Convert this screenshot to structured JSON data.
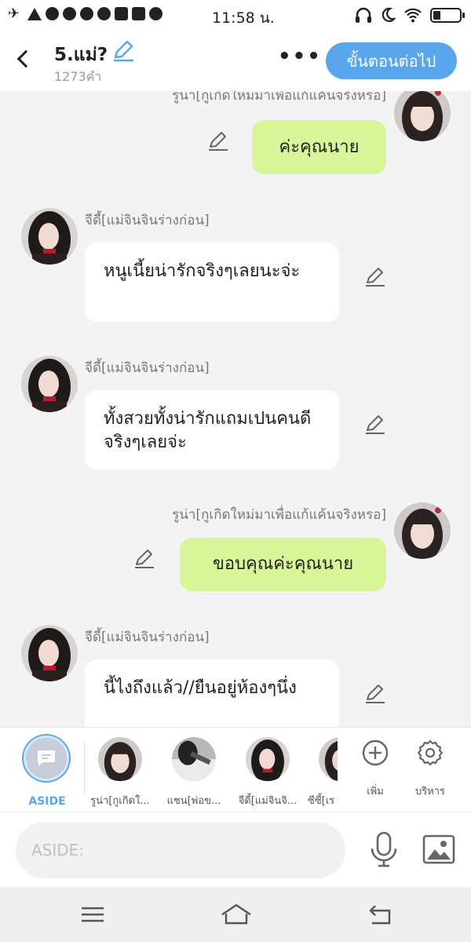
{
  "status_bar": {
    "time": "11:58 น."
  },
  "header": {
    "title": "5.แม่?",
    "word_count": "1273คำ",
    "more": "•••",
    "next_button": "ขั้นตอนต่อไป"
  },
  "messages": [
    {
      "side": "right",
      "name": "รูน่า[กูเกิดใหม่มาเพื่อแก้แค้นจริงหรอ]",
      "text": "ค่ะคุณนาย"
    },
    {
      "side": "left",
      "name": "จีดี้[แม่จินจินร่างก่อน]",
      "text": "หนูเนี้ยน่ารักจริงๆเลยนะจ่ะ"
    },
    {
      "side": "left",
      "name": "จีดี้[แม่จินจินร่างก่อน]",
      "text": "ทั้งสวยทั้งน่ารักแถมเปนคนดีจริงๆเลยจ่ะ"
    },
    {
      "side": "right",
      "name": "รูน่า[กูเกิดใหม่มาเพื่อแก้แค้นจริงหรอ]",
      "text": "ขอบคุณค่ะคุณนาย"
    },
    {
      "side": "left",
      "name": "จีดี้[แม่จินจินร่างก่อน]",
      "text": "นี้ไงถึงแล้ว//ยืนอยู่ห้องๆนึ่ง"
    }
  ],
  "character_bar": {
    "aside_label": "ASIDE",
    "characters": [
      {
        "label": "รูน่า[กูเกิดใ..."
      },
      {
        "label": "แชน[พ่อข..."
      },
      {
        "label": "จีดี้[แม่จินจิ..."
      },
      {
        "label": "ซีซี้[เร"
      }
    ],
    "add_label": "เพิ่ม",
    "manage_label": "บริหาร"
  },
  "input": {
    "placeholder": "ASIDE:"
  }
}
